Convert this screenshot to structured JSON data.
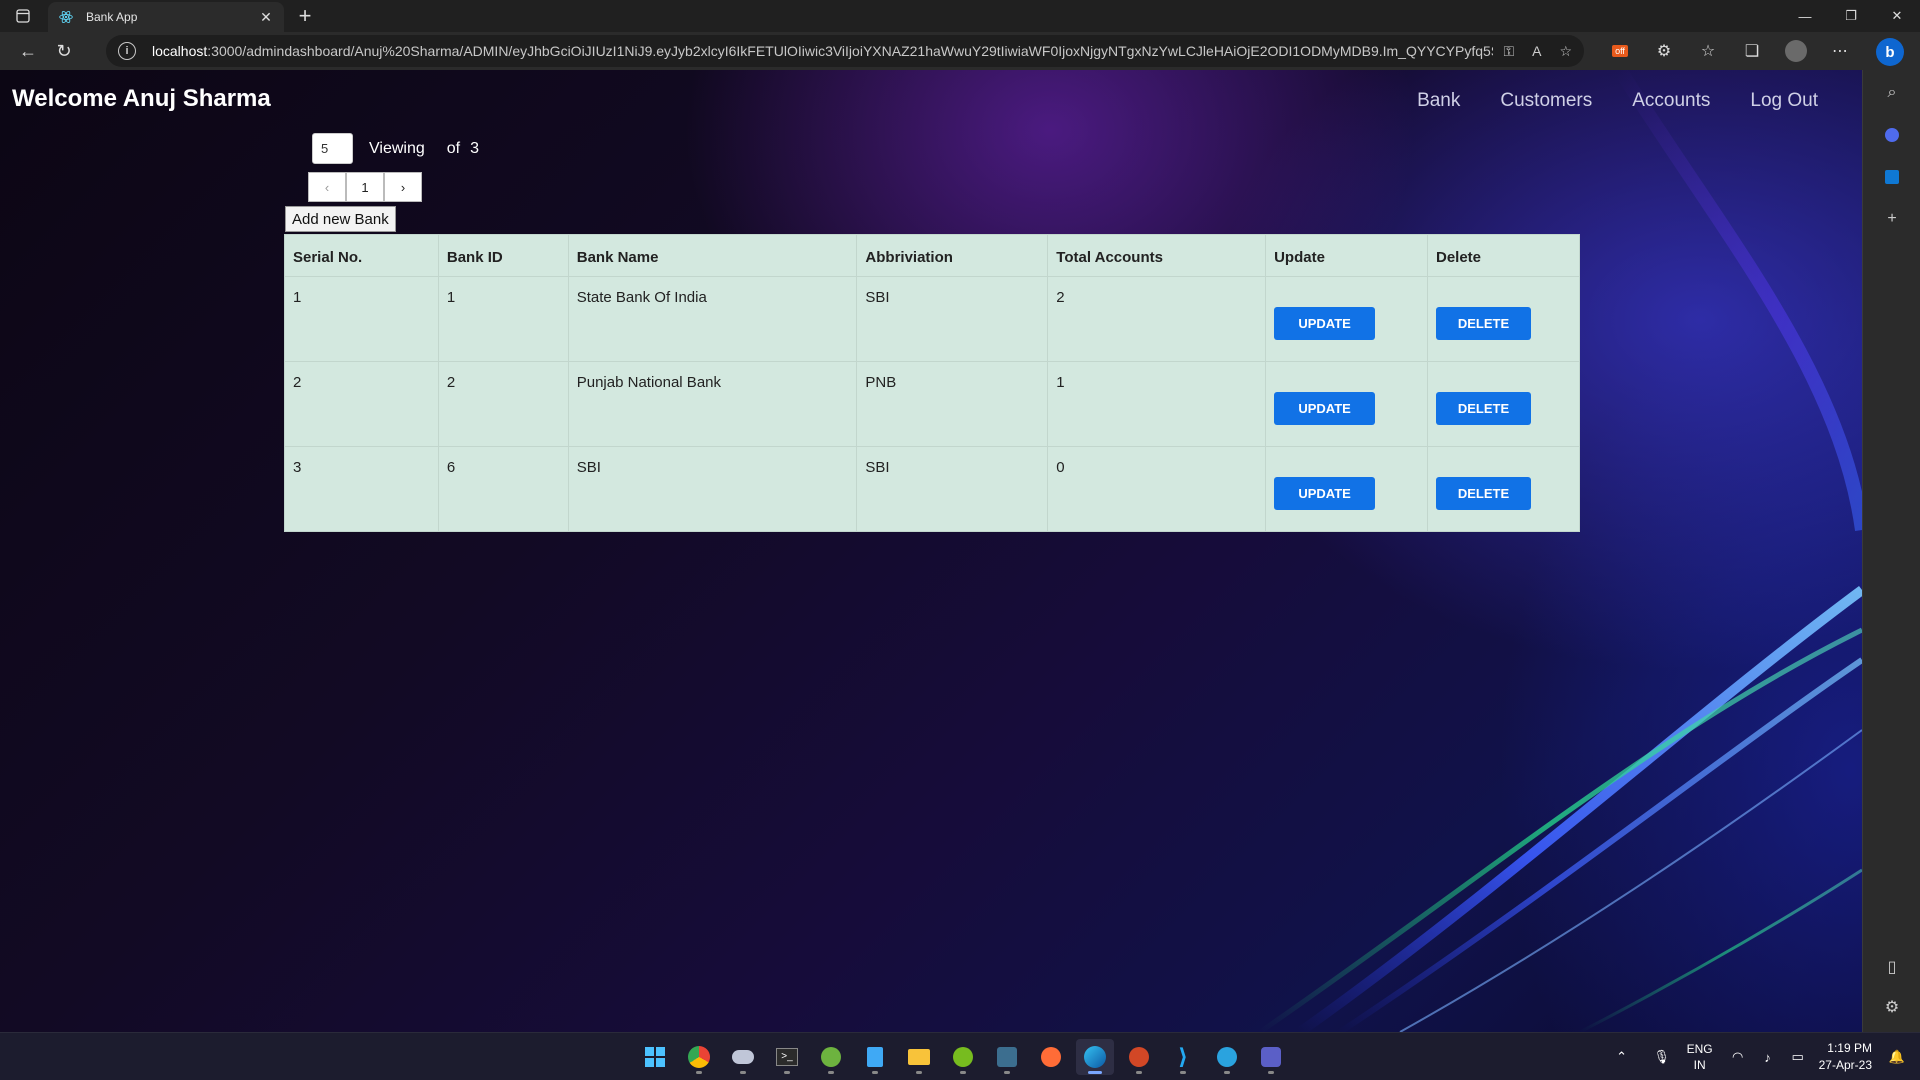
{
  "browser": {
    "tab_title": "Bank App",
    "url_host": "localhost",
    "url_rest": ":3000/admindashboard/Anuj%20Sharma/ADMIN/eyJhbGciOiJIUzI1NiJ9.eyJyb2xlcyI6IkFETUlOIiwic3ViIjoiYXNAZ21haWwuY29tIiwiaWF0IjoxNjgyNTgxNzYwLCJleHAiOjE2ODI1ODMyMDB9.Im_QYYCYPyfq5Svd..."
  },
  "header": {
    "welcome": "Welcome Anuj Sharma",
    "nav": [
      "Bank",
      "Customers",
      "Accounts",
      "Log Out"
    ]
  },
  "pager": {
    "page_size": "5",
    "viewing_label": "Viewing",
    "of_label": "of",
    "total": "3",
    "current_page": "1",
    "prev": "‹",
    "next": "›"
  },
  "add_bank_label": "Add new Bank",
  "table": {
    "headers": [
      "Serial No.",
      "Bank ID",
      "Bank Name",
      "Abbriviation",
      "Total Accounts",
      "Update",
      "Delete"
    ],
    "rows": [
      {
        "serial": "1",
        "bank_id": "1",
        "name": "State Bank Of India",
        "abbr": "SBI",
        "total_accounts": "2",
        "update": "UPDATE",
        "delete": "DELETE"
      },
      {
        "serial": "2",
        "bank_id": "2",
        "name": "Punjab National Bank",
        "abbr": "PNB",
        "total_accounts": "1",
        "update": "UPDATE",
        "delete": "DELETE"
      },
      {
        "serial": "3",
        "bank_id": "6",
        "name": "SBI",
        "abbr": "SBI",
        "total_accounts": "0",
        "update": "UPDATE",
        "delete": "DELETE"
      }
    ]
  },
  "taskbar": {
    "lang_top": "ENG",
    "lang_bottom": "IN",
    "time": "1:19 PM",
    "date": "27-Apr-23"
  },
  "colors": {
    "table_bg": "#d3e8df",
    "button_blue": "#1172e6",
    "page_text": "#ffffff"
  }
}
